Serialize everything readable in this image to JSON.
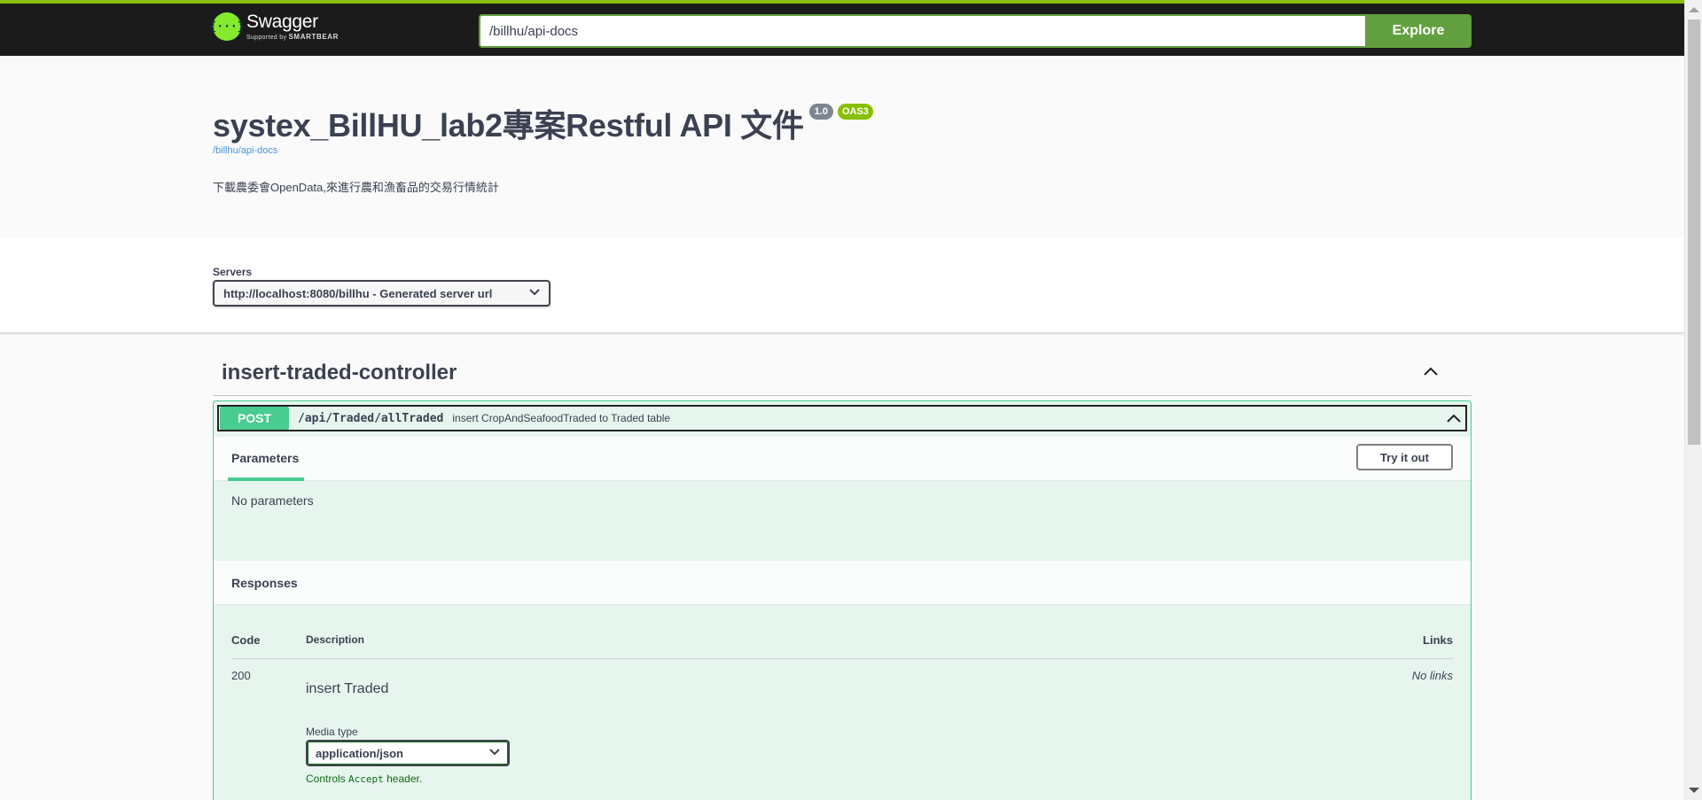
{
  "topbar": {
    "logo_badge": "{···}",
    "logo_title": "Swagger",
    "logo_supported": "Supported by",
    "logo_brand": "SMARTBEAR",
    "url_value": "/billhu/api-docs",
    "explore_label": "Explore"
  },
  "info": {
    "title": "systex_BillHU_lab2專案Restful API 文件",
    "version": "1.0",
    "oas": "OAS3",
    "link": "/billhu/api-docs",
    "description": "下載農委會OpenData,來進行農和漁畜品的交易行情統計"
  },
  "servers": {
    "label": "Servers",
    "selected": "http://localhost:8080/billhu - Generated server url"
  },
  "controller": {
    "name": "insert-traded-controller",
    "operation": {
      "method": "POST",
      "path": "/api/Traded/allTraded",
      "summary": "insert CropAndSeafoodTraded to Traded table",
      "parameters_tab": "Parameters",
      "try_it_out": "Try it out",
      "no_parameters": "No parameters",
      "responses_title": "Responses",
      "columns": {
        "code": "Code",
        "description": "Description",
        "links": "Links"
      },
      "responses": [
        {
          "code": "200",
          "description": "insert Traded",
          "links": "No links",
          "media_type_label": "Media type",
          "media_type": "application/json",
          "controls_prefix": "Controls",
          "controls_code": "Accept",
          "controls_suffix": "header."
        }
      ]
    }
  },
  "colors": {
    "topbar_bg": "#1b1b1b",
    "explore_green": "#62a03f",
    "post_green": "#49cc90",
    "version_badge": "#7d8492",
    "oas_badge": "#89bf04",
    "link_blue": "#4990e2"
  }
}
